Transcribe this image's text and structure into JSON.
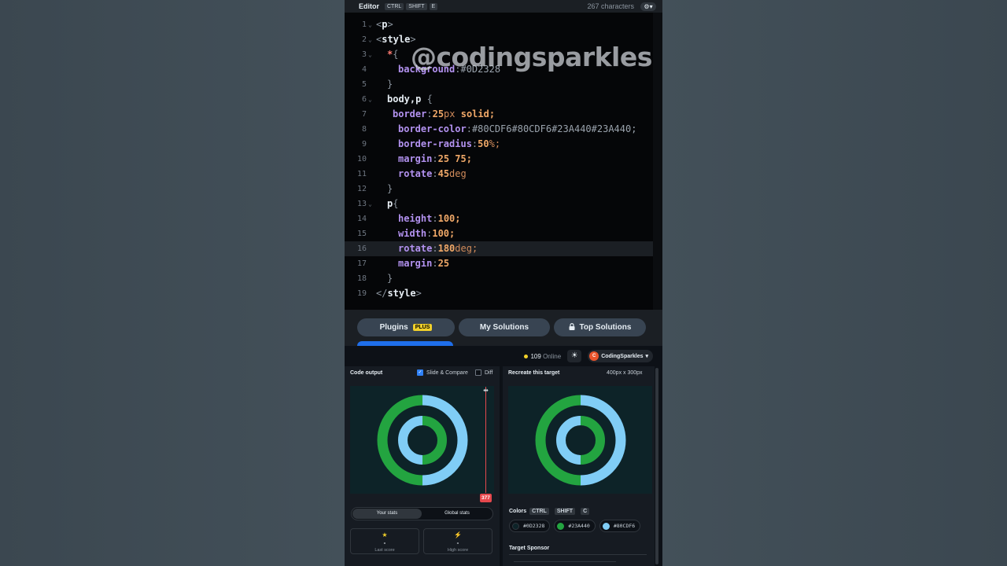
{
  "editor_header": {
    "title": "Editor",
    "shortcut": [
      "CTRL",
      "SHIFT",
      "E"
    ],
    "char_count": "267 characters",
    "settings_icon": "gear-icon"
  },
  "watermark": "@codingsparkles",
  "code_lines": [
    {
      "num": "1"
    },
    {
      "num": "2"
    },
    {
      "num": "3"
    },
    {
      "num": "4"
    },
    {
      "num": "5"
    },
    {
      "num": "6"
    },
    {
      "num": "7"
    },
    {
      "num": "8"
    },
    {
      "num": "9"
    },
    {
      "num": "10"
    },
    {
      "num": "11"
    },
    {
      "num": "12"
    },
    {
      "num": "13"
    },
    {
      "num": "14"
    },
    {
      "num": "15"
    },
    {
      "num": "16"
    },
    {
      "num": "17"
    },
    {
      "num": "18"
    },
    {
      "num": "19"
    }
  ],
  "code": {
    "l1": {
      "open": "<",
      "tag": "p",
      "close": ">"
    },
    "l2": {
      "open": "<",
      "tag": "style",
      "close": ">"
    },
    "l3": {
      "sel": "*",
      "brace": "{"
    },
    "l4": {
      "prop": "background",
      "colon": ":",
      "val": "#0D2328"
    },
    "l5": {
      "brace": "}"
    },
    "l6": {
      "sel": "body,p",
      "brace": "{"
    },
    "l7": {
      "prop": "border",
      "colon": ":",
      "num": "25",
      "unit": "px",
      "kw": " solid;"
    },
    "l8": {
      "prop": "border-color",
      "colon": ":",
      "val": "#80CDF6#80CDF6#23A440#23A440;"
    },
    "l9": {
      "prop": "border-radius",
      "colon": ":",
      "num": "50",
      "unit": "%;"
    },
    "l10": {
      "prop": "margin",
      "colon": ":",
      "num": "25 75;"
    },
    "l11": {
      "prop": "rotate",
      "colon": ":",
      "num": "45",
      "unit": "deg"
    },
    "l12": {
      "brace": "}"
    },
    "l13": {
      "sel": "p",
      "brace": "{"
    },
    "l14": {
      "prop": "height",
      "colon": ":",
      "num": "100;"
    },
    "l15": {
      "prop": "width",
      "colon": ":",
      "num": "100;"
    },
    "l16": {
      "prop": "rotate",
      "colon": ":",
      "num": "180",
      "unit": "deg;"
    },
    "l17": {
      "prop": "margin",
      "colon": ":",
      "num": "25"
    },
    "l18": {
      "brace": "}"
    },
    "l19": {
      "open": "</",
      "tag": "style",
      "close": ">"
    }
  },
  "tabs": {
    "plugins": "Plugins",
    "plus_badge": "PLUS",
    "my_solutions": "My Solutions",
    "top_solutions": "Top Solutions",
    "lock_icon": "lock-icon"
  },
  "status": {
    "online_count": "109",
    "online_label": "Online",
    "theme_icon": "sun-icon",
    "user_initial": "C",
    "user_name": "CodingSparkles"
  },
  "output_panel": {
    "title": "Code output",
    "slide_compare": "Slide & Compare",
    "slide_compare_checked": true,
    "diff": "Diff",
    "diff_checked": false,
    "slider_value": "377",
    "stats_tabs": [
      "Your stats",
      "Global stats"
    ],
    "last_score": {
      "value": "-",
      "label": "Last score",
      "icon": "star-icon"
    },
    "high_score": {
      "value": "-",
      "label": "High score",
      "icon": "bolt-icon"
    }
  },
  "target_panel": {
    "title": "Recreate this target",
    "size": "400px x 300px",
    "colors_label": "Colors",
    "colors_shortcut": [
      "CTRL",
      "SHIFT",
      "C"
    ],
    "colors": [
      {
        "hex": "#0D2328",
        "label": "#0D2328"
      },
      {
        "hex": "#23A440",
        "label": "#23A440"
      },
      {
        "hex": "#80CDF6",
        "label": "#80CDF6"
      }
    ],
    "sponsor_label": "Target Sponsor"
  },
  "palette": {
    "bg": "#0D2328",
    "green": "#23A440",
    "blue": "#80CDF6"
  }
}
